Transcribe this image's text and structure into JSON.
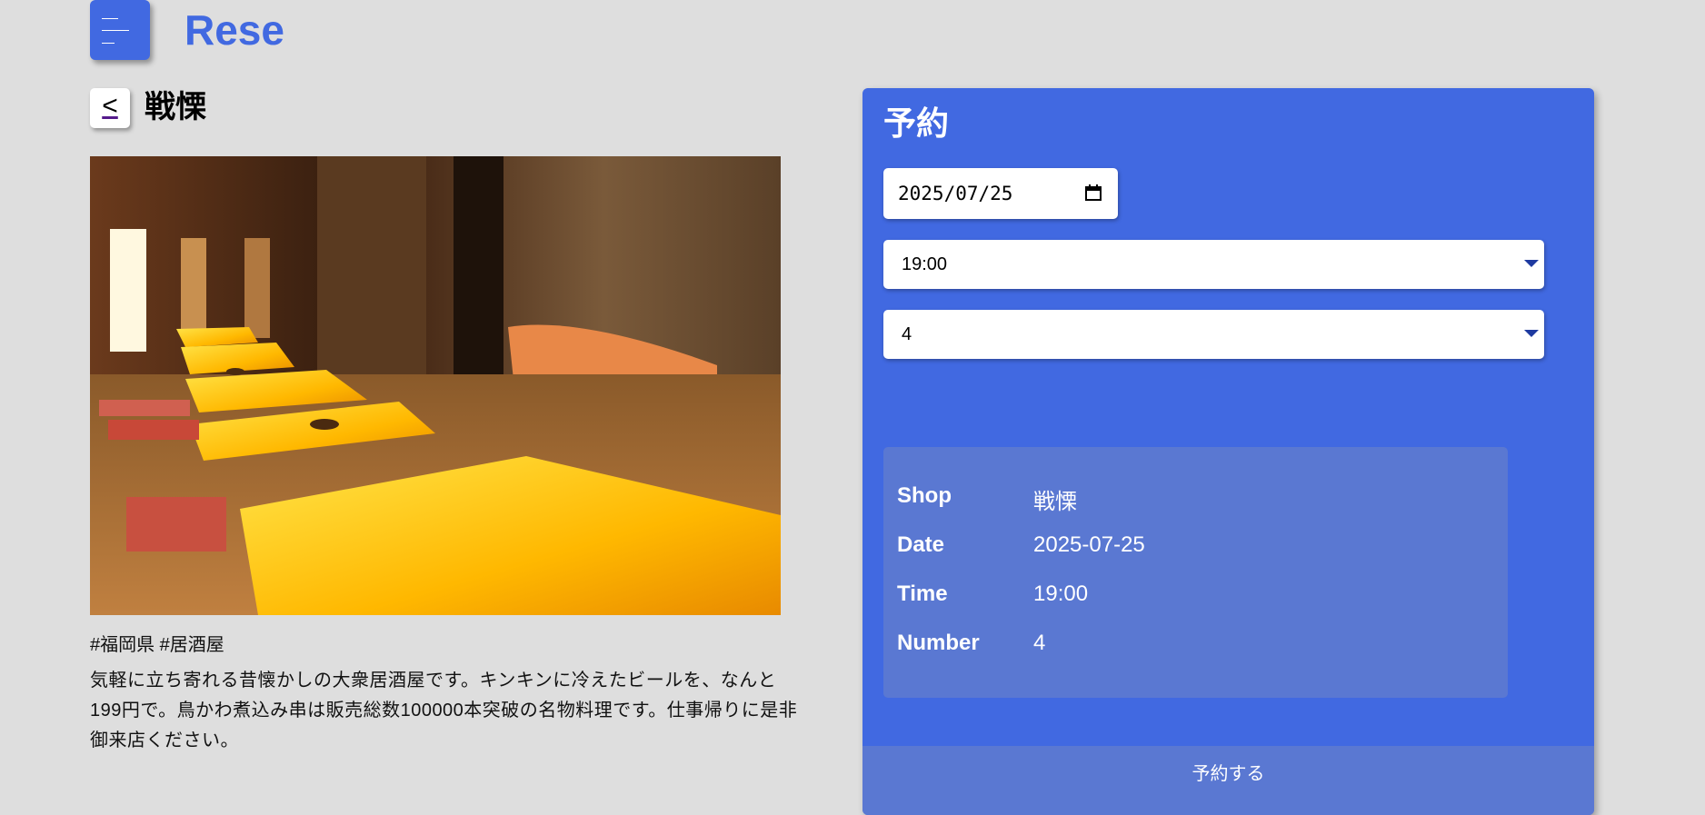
{
  "header": {
    "logo": "Rese",
    "menu_icon": "hamburger-icon"
  },
  "shop": {
    "back_label": "<",
    "name": "戦慄",
    "tags": "#福岡県 #居酒屋",
    "description": "気軽に立ち寄れる昔懐かしの大衆居酒屋です。キンキンに冷えたビールを、なんと199円で。鳥かわ煮込み串は販売総数100000本突破の名物料理です。仕事帰りに是非御来店ください。"
  },
  "reservation": {
    "title": "予約",
    "date_value": "2025/07/25",
    "time_value": "19:00",
    "number_value": "4",
    "summary": {
      "shop_label": "Shop",
      "shop_value": "戦慄",
      "date_label": "Date",
      "date_value": "2025-07-25",
      "time_label": "Time",
      "time_value": "19:00",
      "number_label": "Number",
      "number_value": "4"
    },
    "submit_label": "予約する"
  },
  "colors": {
    "accent": "#4169e1",
    "background": "#dedede",
    "summary_bg": "#5a78d2"
  }
}
